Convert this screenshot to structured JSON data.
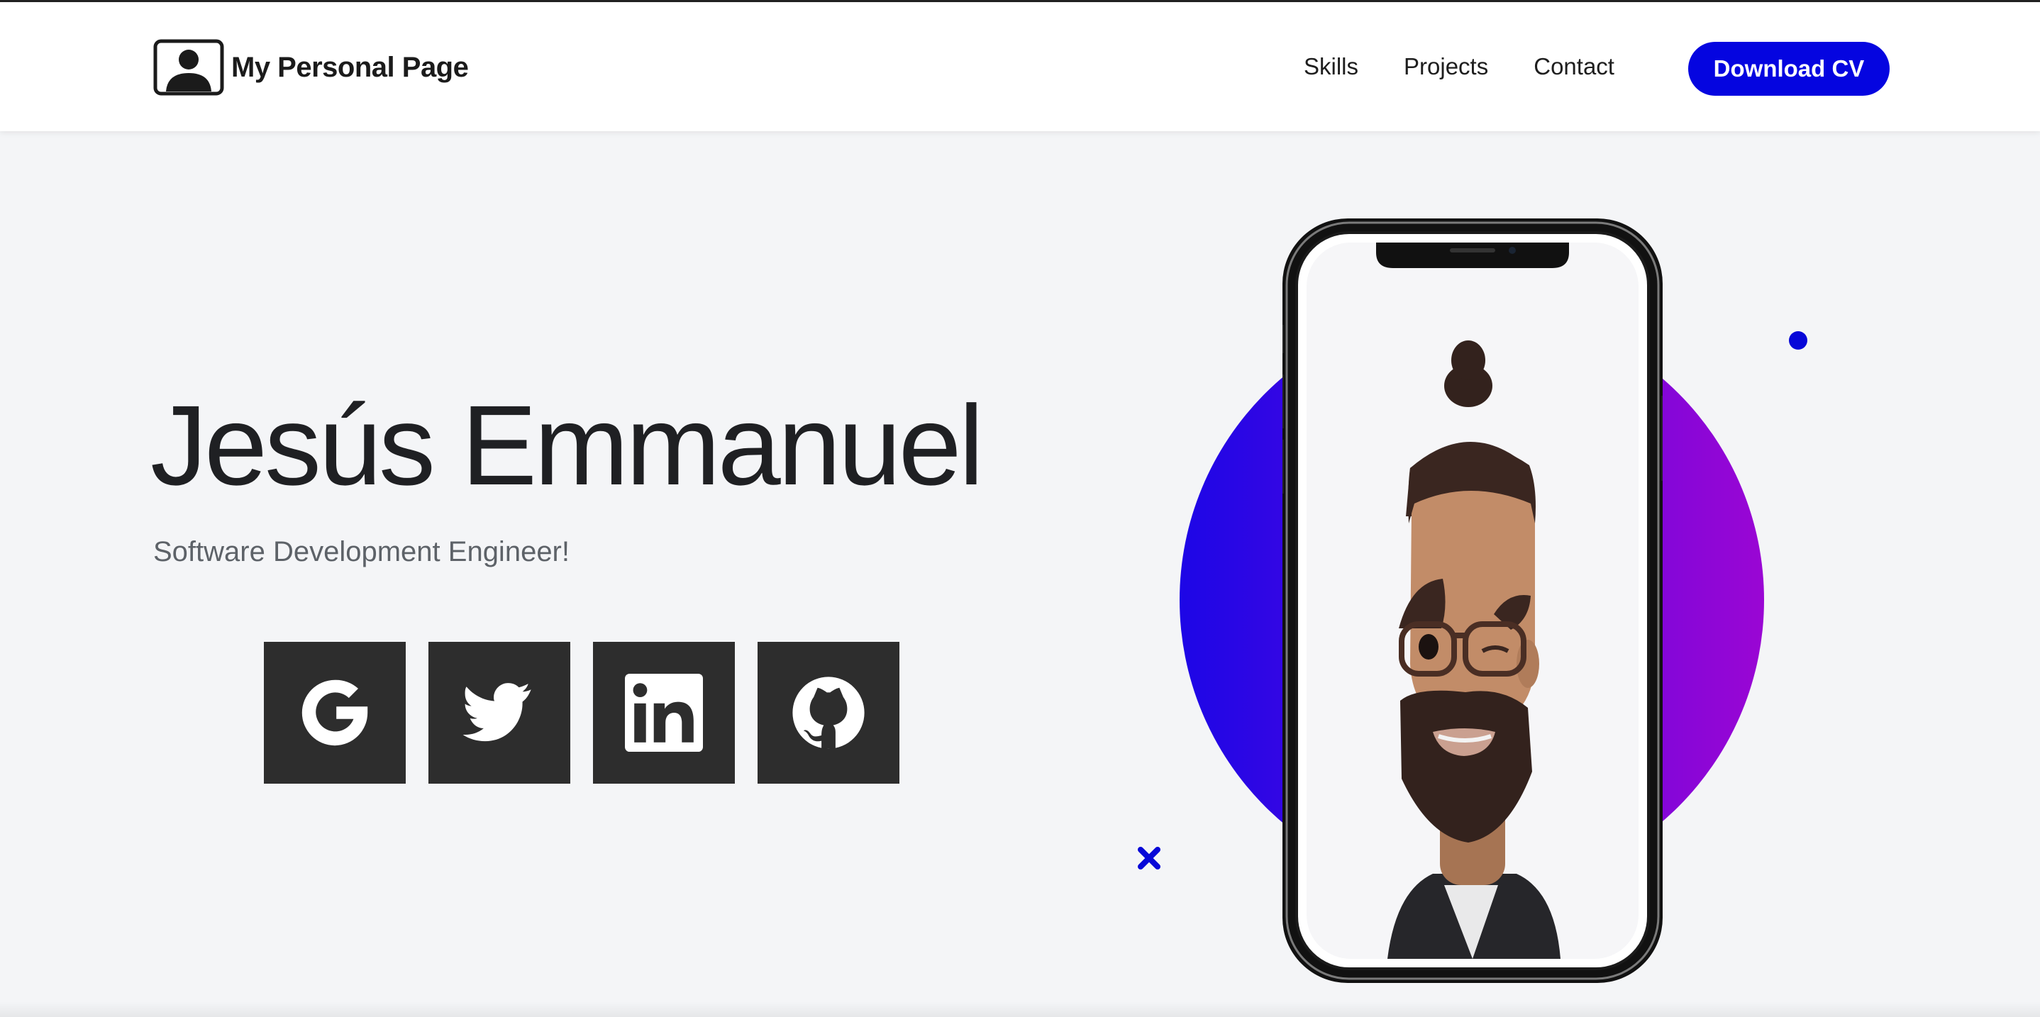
{
  "nav": {
    "brand_text": "My Personal Page",
    "brand_icon": "portrait-icon",
    "links": [
      "Skills",
      "Projects",
      "Contact"
    ],
    "cta_label": "Download CV"
  },
  "hero": {
    "name": "Jesús Emmanuel",
    "subtitle": "Software Development Engineer!",
    "social_icons": [
      "google-icon",
      "twitter-icon",
      "linkedin-icon",
      "github-icon"
    ]
  },
  "colors": {
    "accent": "#0505e0",
    "circle_start": "#1d06e6",
    "circle_end": "#9a06d4",
    "social_bg": "#2d2d2d",
    "page_bg": "#f4f5f7"
  }
}
